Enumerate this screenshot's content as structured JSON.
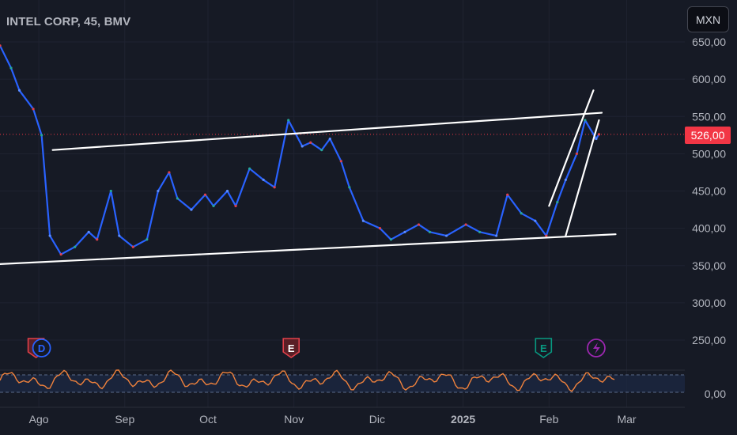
{
  "header": {
    "title": "INTEL CORP, 45, BMV",
    "currency_button": "MXN"
  },
  "price_tag": {
    "value": "526,00",
    "color": "#f23645"
  },
  "colors": {
    "background": "#161a25",
    "price_line": "#2962ff",
    "oscillator": "#f0823c",
    "trendlines": "#ffffff",
    "earnings": "#e0404a",
    "dividend": "#2962ff",
    "earnings_future": "#089981",
    "split": "#9c27b0"
  },
  "event_markers": [
    {
      "icon": "earnings-icon",
      "label": "E",
      "date": "2024-07-31"
    },
    {
      "icon": "dividend-icon",
      "label": "D",
      "date": "2024-08-02"
    },
    {
      "icon": "earnings-icon",
      "label": "E",
      "date": "2024-10-31"
    },
    {
      "icon": "earnings-future-icon",
      "label": "E",
      "date": "2025-01-30"
    },
    {
      "icon": "lightning-icon",
      "label": "",
      "date": "2025-02-18"
    }
  ],
  "chart_data": {
    "type": "line",
    "title": "INTEL CORP, 45, BMV",
    "x_axis": {
      "labels": [
        "Ago",
        "Sep",
        "Oct",
        "Nov",
        "Dic",
        "2025",
        "Feb",
        "Mar"
      ]
    },
    "y_axis": {
      "labels": [
        "650,00",
        "600,00",
        "550,00",
        "500,00",
        "450,00",
        "400,00",
        "350,00",
        "300,00",
        "250,00"
      ],
      "range": [
        213,
        660
      ]
    },
    "oscillator": {
      "label": "0,00",
      "upper_band": 80,
      "lower_band": 20
    },
    "series": [
      {
        "x": [
          "2024-07-18",
          "2024-07-22",
          "2024-07-25",
          "2024-07-30",
          "2024-08-02",
          "2024-08-05",
          "2024-08-09",
          "2024-08-14",
          "2024-08-19",
          "2024-08-22",
          "2024-08-27",
          "2024-08-30",
          "2024-09-04",
          "2024-09-09",
          "2024-09-13",
          "2024-09-17",
          "2024-09-20",
          "2024-09-25",
          "2024-09-30",
          "2024-10-03",
          "2024-10-08",
          "2024-10-11",
          "2024-10-16",
          "2024-10-21",
          "2024-10-25",
          "2024-10-30",
          "2024-11-04",
          "2024-11-07",
          "2024-11-11",
          "2024-11-14",
          "2024-11-18",
          "2024-11-21",
          "2024-11-26",
          "2024-12-02",
          "2024-12-06",
          "2024-12-11",
          "2024-12-16",
          "2024-12-20",
          "2024-12-26",
          "2025-01-02",
          "2025-01-07",
          "2025-01-13",
          "2025-01-17",
          "2025-01-22",
          "2025-01-27",
          "2025-01-31",
          "2025-02-04",
          "2025-02-07",
          "2025-02-11",
          "2025-02-14",
          "2025-02-18",
          "2025-02-19"
        ],
        "values": [
          645,
          615,
          585,
          560,
          525,
          390,
          365,
          375,
          395,
          385,
          450,
          390,
          375,
          385,
          450,
          475,
          440,
          425,
          445,
          430,
          450,
          430,
          480,
          465,
          455,
          545,
          510,
          515,
          505,
          520,
          490,
          455,
          410,
          400,
          385,
          395,
          405,
          395,
          390,
          405,
          395,
          390,
          445,
          420,
          410,
          390,
          435,
          465,
          500,
          545,
          520,
          526
        ]
      }
    ],
    "annotations": [
      {
        "type": "trendline",
        "name": "channel-upper",
        "from": [
          "2024-08-06",
          505
        ],
        "to": [
          "2025-02-20",
          555
        ]
      },
      {
        "type": "trendline",
        "name": "channel-lower",
        "from": [
          "2024-07-18",
          352
        ],
        "to": [
          "2025-02-25",
          392
        ]
      },
      {
        "type": "trendline",
        "name": "wedge-left",
        "from": [
          "2025-02-01",
          430
        ],
        "to": [
          "2025-02-17",
          585
        ]
      },
      {
        "type": "trendline",
        "name": "wedge-right",
        "from": [
          "2025-02-07",
          390
        ],
        "to": [
          "2025-02-19",
          545
        ]
      }
    ]
  }
}
